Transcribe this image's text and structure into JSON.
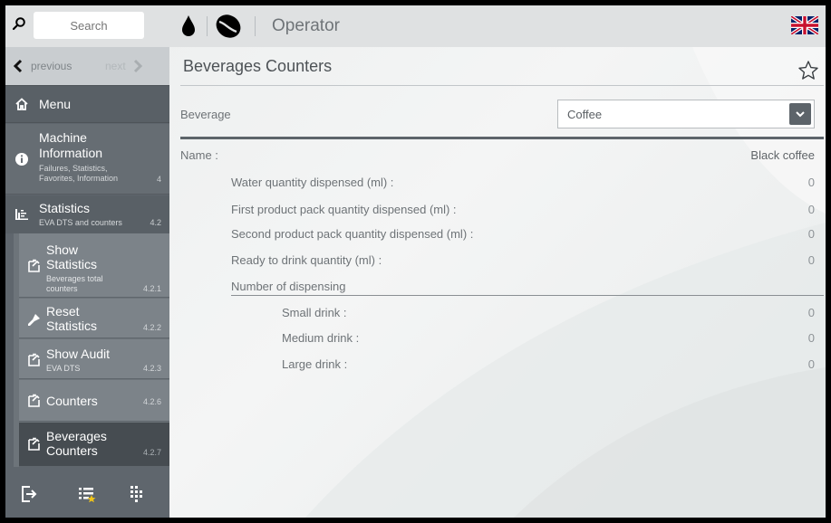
{
  "sidebar": {
    "search_placeholder": "Search",
    "nav": {
      "previous": "previous",
      "next": "next"
    },
    "menu_label": "Menu",
    "machine": {
      "title": "Machine",
      "title2": "Information",
      "sub1": "Failures, Statistics,",
      "sub2": "Favorites, Information",
      "num": "4"
    },
    "statistics": {
      "title": "Statistics",
      "sub": "EVA DTS and counters",
      "num": "4.2"
    },
    "sub_items": [
      {
        "l1": "Show",
        "l2": "Statistics",
        "s1": "Beverages total",
        "s2": "counters",
        "num": "4.2.1",
        "icon": "hand-icon"
      },
      {
        "l1": "Reset",
        "l2": "Statistics",
        "num": "4.2.2",
        "icon": "brush-icon"
      },
      {
        "l1": "Show Audit",
        "s1": "EVA DTS",
        "num": "4.2.3",
        "icon": "hand-icon"
      },
      {
        "l1": "Counters",
        "num": "4.2.6",
        "icon": "hand-icon"
      },
      {
        "l1": "Beverages",
        "l2": "Counters",
        "num": "4.2.7",
        "icon": "hand-icon"
      }
    ],
    "bottom_icons": [
      "logout-icon",
      "favorites-list-icon",
      "keypad-icon"
    ]
  },
  "header": {
    "title": "Operator",
    "icons": [
      "water-drop-icon",
      "coffee-bean-icon",
      "uk-flag-icon"
    ]
  },
  "page": {
    "title": "Beverages Counters",
    "beverage_label": "Beverage",
    "beverage_selected": "Coffee",
    "name_label": "Name :",
    "name_value": "Black coffee",
    "rows": [
      {
        "label": "Water quantity dispensed (ml) :",
        "value": "0"
      },
      {
        "label": "First product pack quantity dispensed (ml) :",
        "value": "0"
      },
      {
        "label": "Second product pack quantity dispensed (ml) :",
        "value": "0"
      },
      {
        "label": "Ready to drink quantity (ml) :",
        "value": "0"
      }
    ],
    "dispensing_title": "Number of dispensing",
    "dispensing_rows": [
      {
        "label": "Small drink :",
        "value": "0"
      },
      {
        "label": "Medium drink :",
        "value": "0"
      },
      {
        "label": "Large drink :",
        "value": "0"
      }
    ]
  },
  "colors": {
    "sidebar": "#5f666d",
    "active_item": "#464c51",
    "header": "#dfe1e2",
    "accent": "#5d646a"
  }
}
